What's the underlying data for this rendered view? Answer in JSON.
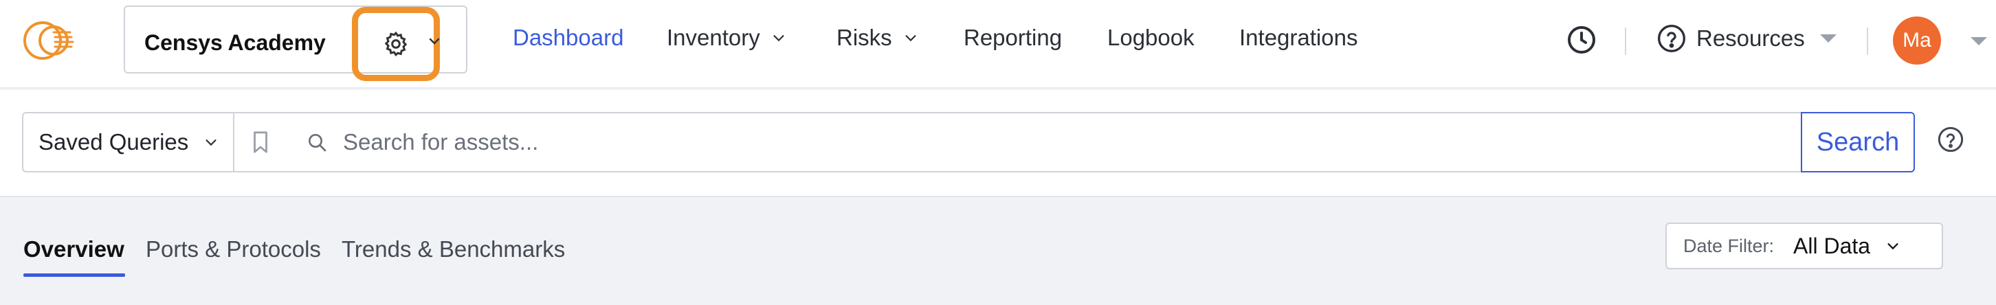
{
  "header": {
    "workspace_name": "Censys Academy",
    "nav": [
      {
        "label": "Dashboard",
        "active": true
      },
      {
        "label": "Inventory",
        "has_dropdown": true
      },
      {
        "label": "Risks",
        "has_dropdown": true
      },
      {
        "label": "Reporting"
      },
      {
        "label": "Logbook"
      },
      {
        "label": "Integrations"
      }
    ],
    "resources_label": "Resources",
    "avatar_initials": "Ma",
    "icons": {
      "logo": "censys-logo-icon",
      "settings": "gear-icon",
      "history": "clock-icon",
      "help": "question-circle-icon"
    }
  },
  "search": {
    "saved_queries_label": "Saved Queries",
    "placeholder": "Search for assets...",
    "value": "",
    "button_label": "Search",
    "icons": {
      "bookmark": "bookmark-icon",
      "search": "search-icon",
      "help": "question-circle-icon"
    }
  },
  "tabs": [
    {
      "label": "Overview",
      "active": true
    },
    {
      "label": "Ports & Protocols"
    },
    {
      "label": "Trends & Benchmarks"
    }
  ],
  "date_filter": {
    "label": "Date Filter:",
    "value": "All Data"
  },
  "colors": {
    "accent": "#3b5bdb",
    "highlight": "#f0922b",
    "avatar": "#ef6a2f",
    "logo": "#f0922b"
  }
}
